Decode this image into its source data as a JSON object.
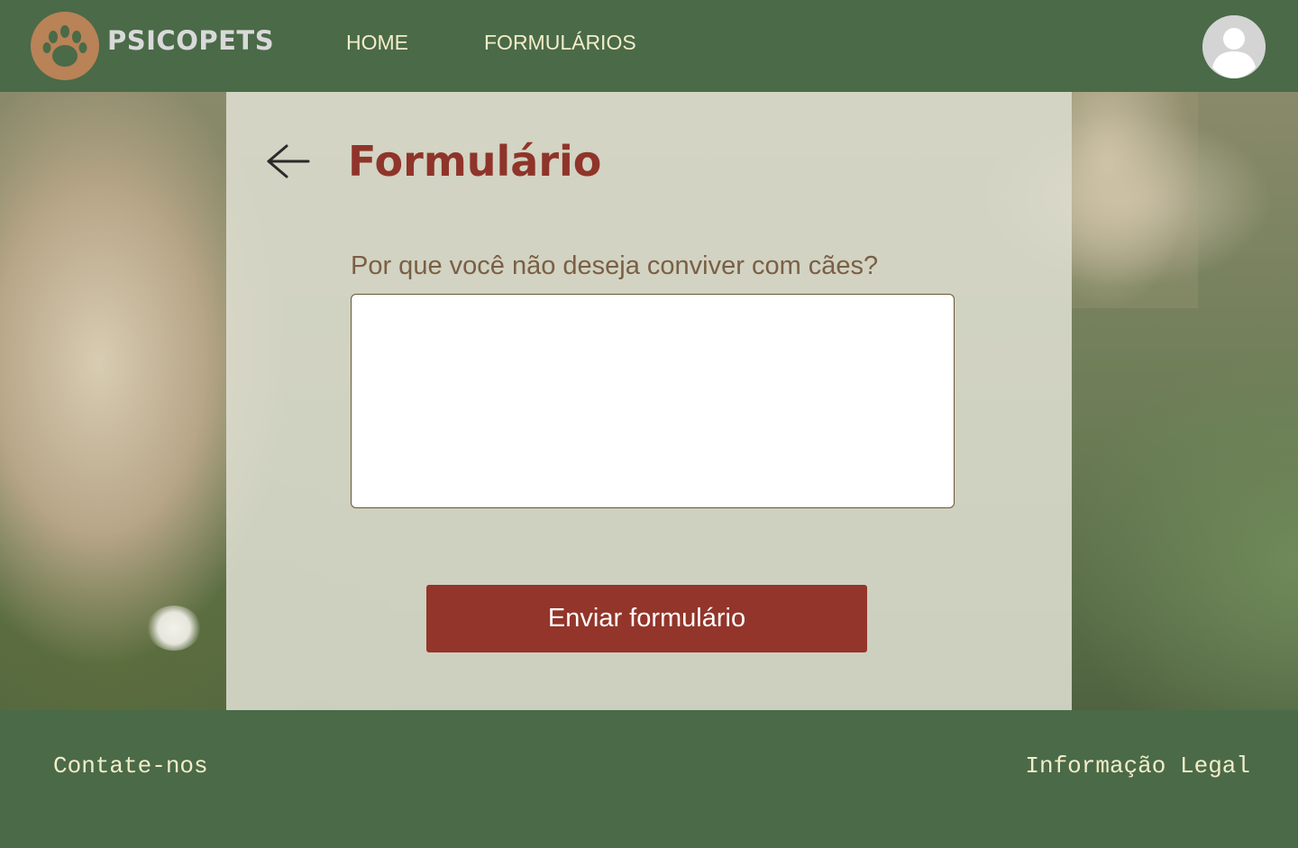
{
  "header": {
    "brand": "PSICOPETS",
    "nav": [
      {
        "label": "HOME"
      },
      {
        "label": "FORMULÁRIOS"
      }
    ],
    "logo_icon": "paw-icon",
    "avatar_icon": "user-avatar-icon"
  },
  "form": {
    "back_icon": "arrow-left-icon",
    "title": "Formulário",
    "question": "Por que você não deseja conviver com cães?",
    "answer_value": "",
    "submit_label": "Enviar formulário"
  },
  "footer": {
    "contact_label": "Contate-nos",
    "legal_label": "Informação Legal"
  },
  "colors": {
    "header_bg": "#4a6a48",
    "title": "#8f342a",
    "button_bg": "#93352a",
    "logo_bg": "#b98257",
    "nav_text": "#f2edc9"
  }
}
